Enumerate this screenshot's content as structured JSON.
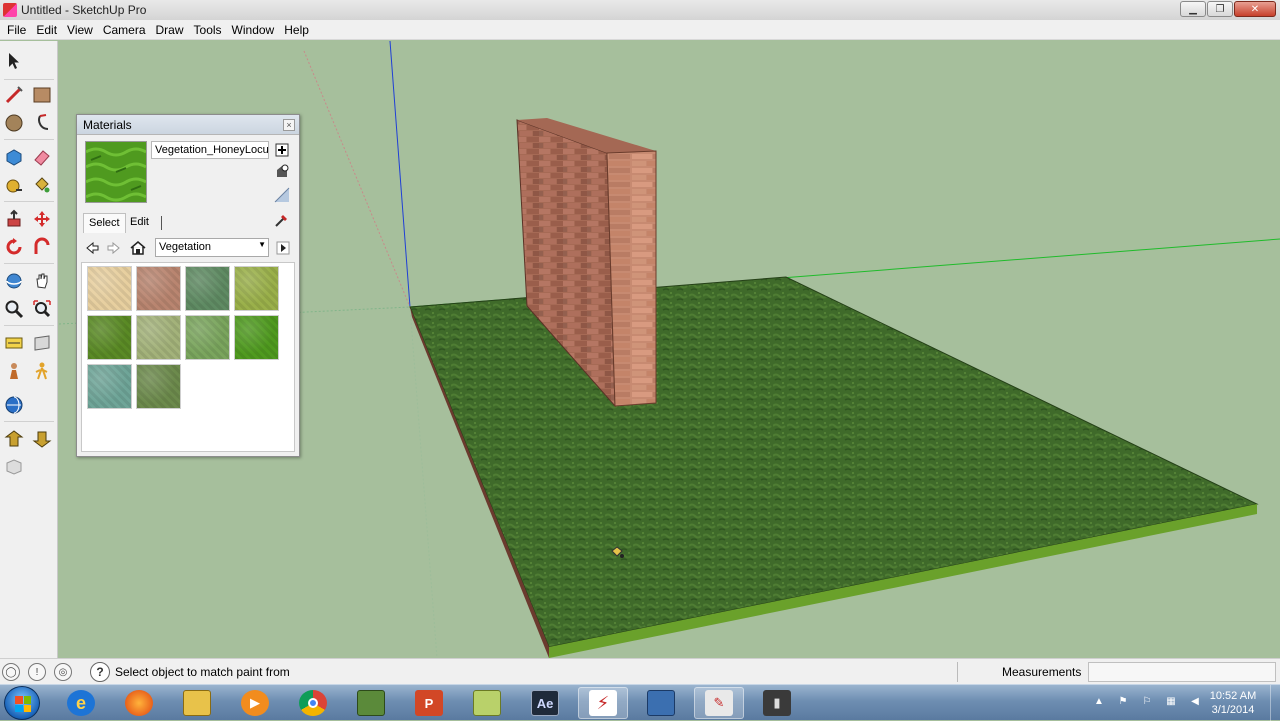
{
  "window": {
    "title": "Untitled - SketchUp Pro"
  },
  "menu": {
    "items": [
      "File",
      "Edit",
      "View",
      "Camera",
      "Draw",
      "Tools",
      "Window",
      "Help"
    ]
  },
  "toolbar": {
    "tools": [
      "select-tool",
      "line-tool",
      "rectangle-tool",
      "circle-tool",
      "arc-tool",
      "make-component-tool",
      "eraser-tool",
      "tape-measure-tool",
      "paint-bucket-tool",
      "push-pull-tool",
      "move-tool",
      "rotate-tool",
      "follow-me-tool",
      "orbit-tool",
      "pan-tool",
      "zoom-tool",
      "zoom-extents-tool",
      "dimension-tool",
      "text-tool",
      "position-camera-tool",
      "walk-tool",
      "look-around-tool",
      "section-plane-tool",
      "add-location-tool",
      "get-models-tool",
      "share-model-tool",
      "extension-warehouse-tool"
    ]
  },
  "materials": {
    "title": "Materials",
    "current_name": "Vegetation_HoneyLocust",
    "tabs": {
      "select": "Select",
      "edit": "Edit"
    },
    "library": "Vegetation",
    "swatch_colors": [
      "#e7cf9f",
      "#b98570",
      "#5f8b63",
      "#9ab04a",
      "#5a8a25",
      "#a3b27a",
      "#7aa55d",
      "#4f9a1f",
      "#6fa598",
      "#6c8a4c"
    ]
  },
  "status": {
    "message": "Select object to match paint from",
    "measurements_label": "Measurements",
    "measurements_value": ""
  },
  "taskbar": {
    "apps": [
      "internet-explorer",
      "firefox",
      "file-explorer",
      "media-player",
      "chrome",
      "sketchup-layout",
      "powerpoint",
      "notepad",
      "after-effects",
      "acrobat",
      "sketchup",
      "sketchup-style-builder",
      "paint-tool"
    ],
    "after_effects_label": "Ae",
    "clock_time": "10:52 AM",
    "clock_date": "3/1/2014"
  },
  "colors": {
    "sky": "#a6bf9c",
    "grass_top": "#3f6a2a",
    "grass_edge": "#6aa12b",
    "brick": "#b46f5c",
    "accent_red": "#c62828"
  }
}
